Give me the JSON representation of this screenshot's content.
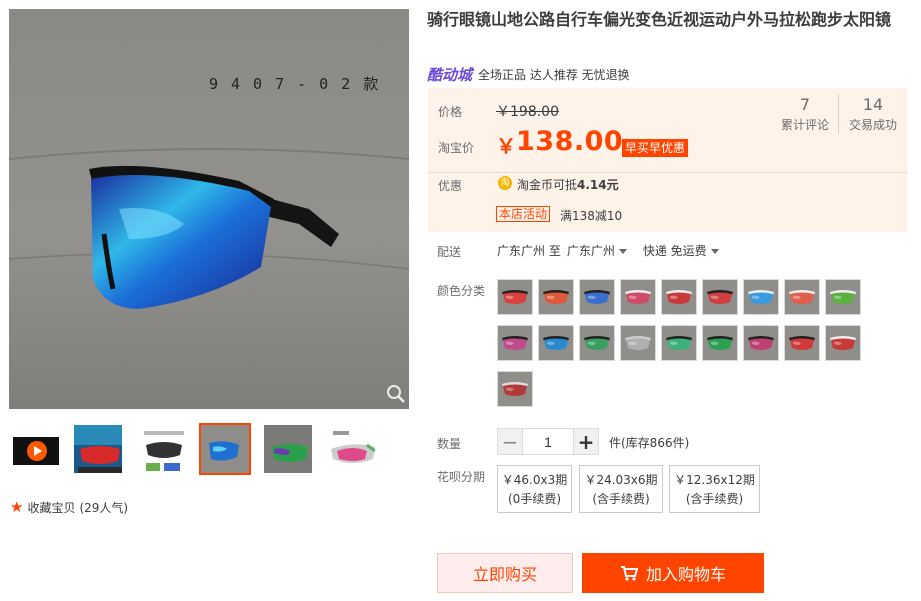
{
  "product": {
    "title": "骑行眼镜山地公路自行车偏光变色近视运动户外马拉松跑步太阳镜",
    "watermark": "9407-02款"
  },
  "shop": {
    "brand": "酷动城",
    "promo_text": "全场正品 达人推荐 无忧退换",
    "brand_color": "#6b4bd8"
  },
  "price": {
    "label": "价格",
    "original": "￥198.00",
    "taobao_label": "淘宝价",
    "currency": "￥",
    "current": "138.00",
    "tag": "早买早优惠",
    "accent_color": "#ff4400"
  },
  "stats": [
    {
      "num": "7",
      "label": "累计评论"
    },
    {
      "num": "14",
      "label": "交易成功"
    }
  ],
  "discount": {
    "label": "优惠",
    "coin_icon": "淘",
    "coin_text_prefix": "淘金币可抵",
    "coin_amount": "4.14元",
    "shop_activity": "本店活动",
    "activity_text": "满138减10"
  },
  "delivery": {
    "label": "配送",
    "from": "广东广州 至",
    "to": "广东广州",
    "method": "快递 免运费"
  },
  "color": {
    "label": "颜色分类",
    "swatches": [
      {
        "lens": "#d94040",
        "frame": "#222"
      },
      {
        "lens": "#e05a3a",
        "frame": "#222"
      },
      {
        "lens": "#3a6fd0",
        "frame": "#222"
      },
      {
        "lens": "#d04a6a",
        "frame": "#eee"
      },
      {
        "lens": "#c83a3a",
        "frame": "#eee"
      },
      {
        "lens": "#d04040",
        "frame": "#222"
      },
      {
        "lens": "#3a9ae0",
        "frame": "#eee"
      },
      {
        "lens": "#e06050",
        "frame": "#eee"
      },
      {
        "lens": "#5ab040",
        "frame": "#eee"
      },
      {
        "lens": "#c04a8a",
        "frame": "#222"
      },
      {
        "lens": "#2a8ad0",
        "frame": "#222"
      },
      {
        "lens": "#3aa060",
        "frame": "#222"
      },
      {
        "lens": "#b0b0b0",
        "frame": "#ccc"
      },
      {
        "lens": "#3ab07a",
        "frame": "#222"
      },
      {
        "lens": "#2aa050",
        "frame": "#222"
      },
      {
        "lens": "#c04070",
        "frame": "#222"
      },
      {
        "lens": "#d03a3a",
        "frame": "#222"
      },
      {
        "lens": "#c83a3a",
        "frame": "#eee"
      },
      {
        "lens": "#b03a3a",
        "frame": "#ddd"
      }
    ]
  },
  "quantity": {
    "label": "数量",
    "value": "1",
    "minus": "−",
    "plus": "+",
    "stock": "件(库存866件)"
  },
  "installment": {
    "label": "花呗分期",
    "options": [
      {
        "line1": "￥46.0x3期",
        "line2": "(0手续费)"
      },
      {
        "line1": "￥24.03x6期",
        "line2": "(含手续费)"
      },
      {
        "line1": "￥12.36x12期",
        "line2": "(含手续费)"
      }
    ]
  },
  "actions": {
    "buy_now": "立即购买",
    "add_cart": "加入购物车"
  },
  "favorite": {
    "text": "收藏宝贝",
    "count": "(29人气)"
  }
}
